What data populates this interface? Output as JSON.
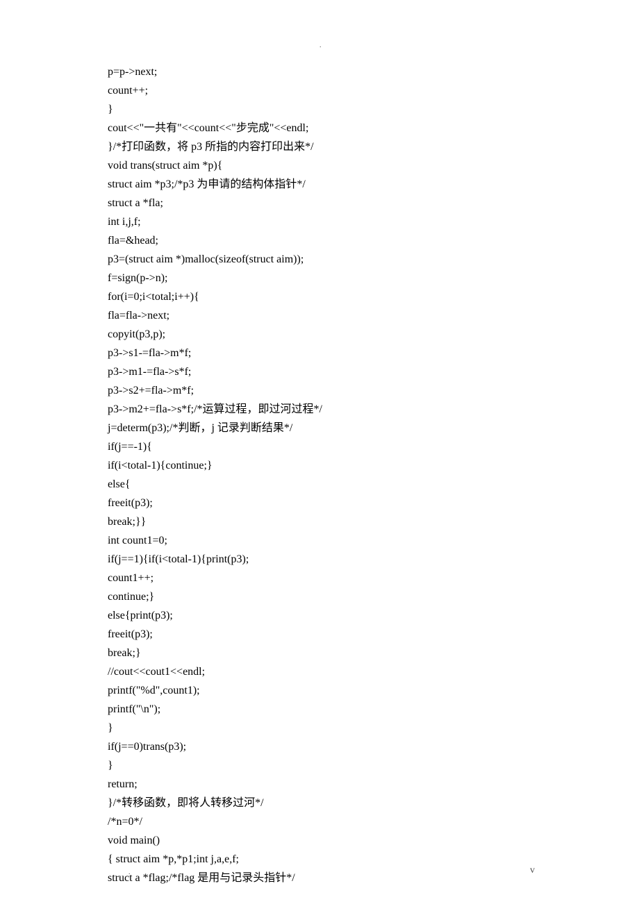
{
  "marks": {
    "dot": ".",
    "page_mark": "v"
  },
  "lines": [
    "p=p->next;",
    "count++;",
    "}",
    "cout<<\"一共有\"<<count<<\"步完成\"<<endl;",
    "}/*打印函数，将 p3 所指的内容打印出来*/",
    "void trans(struct aim *p){",
    "struct aim *p3;/*p3 为申请的结构体指针*/",
    "struct a *fla;",
    "int i,j,f;",
    "fla=&head;",
    "p3=(struct aim *)malloc(sizeof(struct aim));",
    "f=sign(p->n);",
    "for(i=0;i<total;i++){",
    "fla=fla->next;",
    "copyit(p3,p);",
    "p3->s1-=fla->m*f;",
    "p3->m1-=fla->s*f;",
    "p3->s2+=fla->m*f;",
    "p3->m2+=fla->s*f;/*运算过程，即过河过程*/",
    "j=determ(p3);/*判断，j 记录判断结果*/",
    "if(j==-1){",
    "if(i<total-1){continue;}",
    "else{",
    "freeit(p3);",
    "break;}}",
    "int count1=0;",
    "if(j==1){if(i<total-1){print(p3);",
    "count1++;",
    "continue;}",
    "else{print(p3);",
    "freeit(p3);",
    "break;}",
    "//cout<<cout1<<endl;",
    "printf(\"%d\",count1);",
    "printf(\"\\n\");",
    "}",
    "if(j==0)trans(p3);",
    "}",
    "return;",
    "}/*转移函数，即将人转移过河*/",
    "/*n=0*/",
    "void main()",
    "{ struct aim *p,*p1;int j,a,e,f;",
    "struct a *flag;/*flag 是用与记录头指针*/"
  ]
}
